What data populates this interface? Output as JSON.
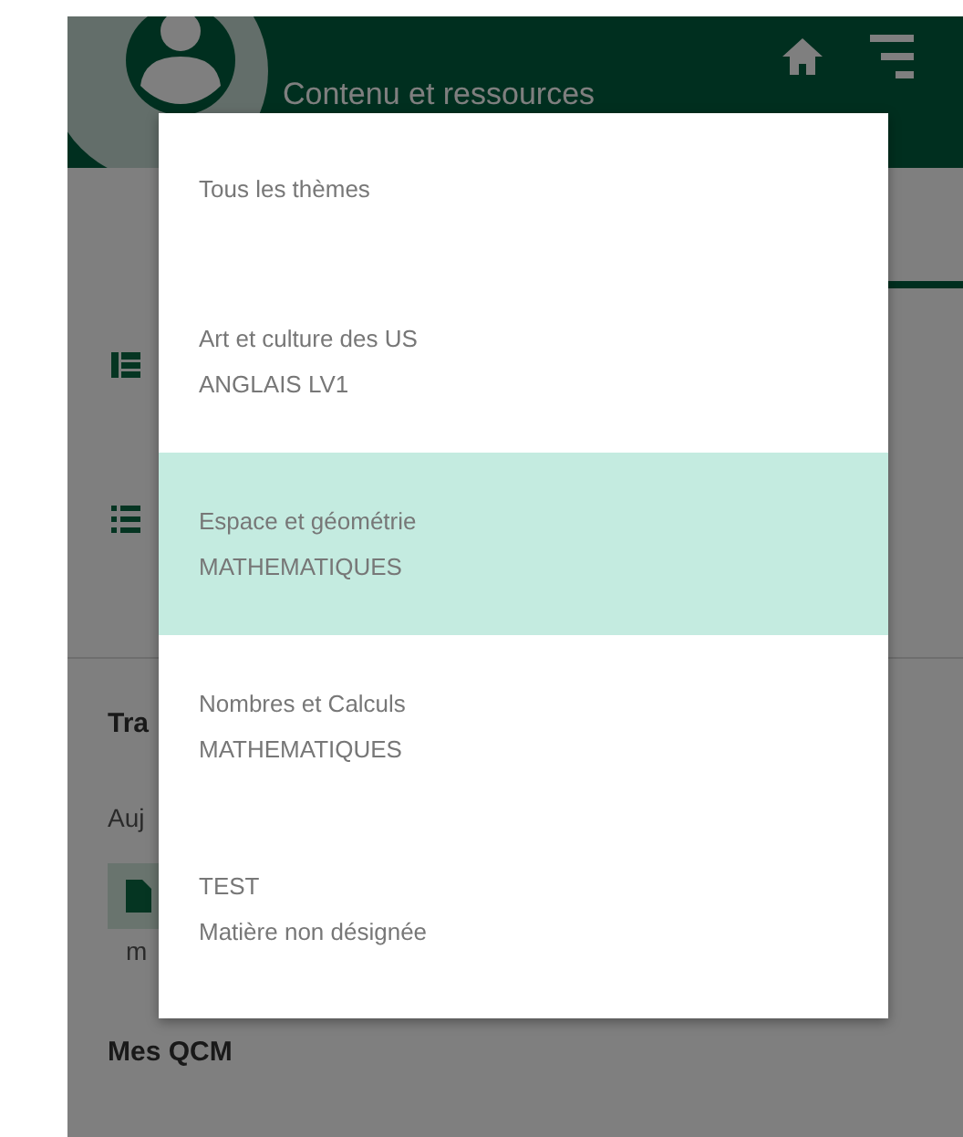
{
  "header": {
    "title": "Contenu et ressources"
  },
  "background": {
    "sections": [
      {
        "kind": "heading",
        "text": "Tra"
      },
      {
        "kind": "note",
        "text": "Auj"
      },
      {
        "kind": "file",
        "text": "m"
      },
      {
        "kind": "heading",
        "text": "Mes QCM"
      }
    ]
  },
  "theme_menu": {
    "items": [
      {
        "title": "Tous les thèmes",
        "selected": false
      },
      {
        "title": "Art et culture des US",
        "subject": "ANGLAIS LV1",
        "selected": false
      },
      {
        "title": "Espace et géométrie",
        "subject": "MATHEMATIQUES",
        "selected": true
      },
      {
        "title": "Nombres et Calculs",
        "subject": "MATHEMATIQUES",
        "selected": false
      },
      {
        "title": "TEST",
        "subject": "Matière non désignée",
        "selected": false
      }
    ]
  }
}
